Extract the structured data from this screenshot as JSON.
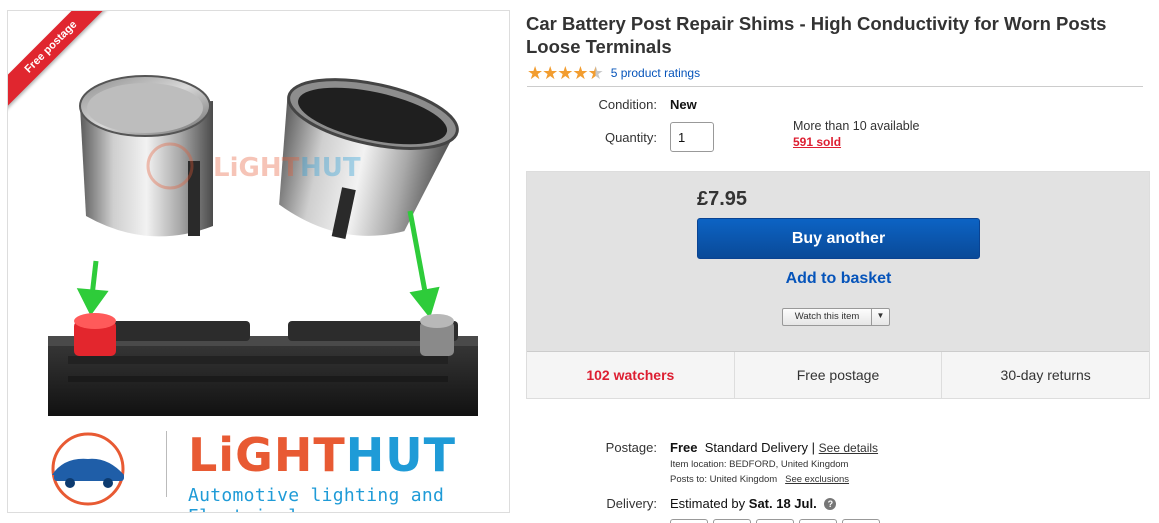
{
  "image": {
    "ribbon_text": "Free postage",
    "brand": {
      "name_part1": "LiGHT",
      "name_part2": "HUT",
      "tagline": "Automotive lighting and Electrical"
    }
  },
  "listing": {
    "title": "Car Battery Post Repair Shims - High Conductivity for Worn Posts Loose Terminals",
    "rating": {
      "stars_value": 4.5,
      "stars_max": 5,
      "ratings_link": "5 product ratings"
    }
  },
  "details": {
    "condition_label": "Condition:",
    "condition_value": "New",
    "quantity_label": "Quantity:",
    "quantity_value": "1",
    "availability": "More than 10 available",
    "sold": "591 sold"
  },
  "buy_box": {
    "price": "£7.95",
    "buy_label": "Buy another",
    "basket_label": "Add to basket",
    "watch_label": "Watch this item",
    "watchers": "102 watchers",
    "free_postage": "Free postage",
    "returns": "30-day returns"
  },
  "shipping": {
    "postage_label": "Postage:",
    "postage_free": "Free",
    "postage_method": "Standard Delivery",
    "postage_sep": "|",
    "see_details": "See details",
    "item_location": "Item location:  BEDFORD, United Kingdom",
    "posts_to": "Posts to:  United Kingdom",
    "see_exclusions": "See exclusions",
    "delivery_label": "Delivery:",
    "delivery_prefix": "Estimated by",
    "delivery_date": "Sat. 18 Jul."
  },
  "colors": {
    "star": "#f29d30",
    "link": "#0654ba",
    "alert_red": "#dd1e31",
    "buy_button": "#0c63c4",
    "brand_orange": "#e85a33",
    "brand_blue": "#1f9bd7",
    "arrow_green": "#2ecc3a"
  },
  "icons": [
    "star-icon",
    "caret-down-icon",
    "help-icon",
    "arrow-down-icon",
    "car-logo-icon"
  ]
}
